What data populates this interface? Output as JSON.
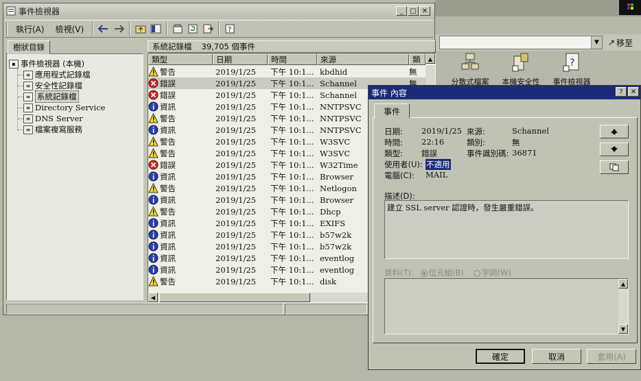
{
  "colors": {
    "title_active": "#1c2a78",
    "error_red": "#cc2b20",
    "warn_yellow": "#f4d820",
    "info_blue": "#2a3fa8"
  },
  "bg": {
    "move_label": "移至",
    "icons": [
      {
        "label": "分散式檔案",
        "icon": "dfs-icon"
      },
      {
        "label": "本機安全性",
        "icon": "local-security-icon"
      },
      {
        "label": "事件檢視器",
        "icon": "event-viewer-icon"
      }
    ]
  },
  "window": {
    "title": "事件檢視器",
    "menu": {
      "action": "執行(A)",
      "view": "檢視(V)"
    }
  },
  "tree": {
    "tab_label": "樹狀目錄",
    "root": "事件檢視器 (本機)",
    "items": [
      "應用程式記錄檔",
      "安全性記錄檔",
      "系統記錄檔",
      "Directory Service",
      "DNS Server",
      "檔案複寫服務"
    ]
  },
  "list": {
    "log_name": "系統記錄檔",
    "event_count": "39,705 個事件",
    "columns": {
      "type": "類型",
      "date": "日期",
      "time": "時間",
      "source": "來源",
      "category": "類"
    },
    "rows": [
      {
        "type": "警告",
        "kind": "warning",
        "date": "2019/1/25",
        "time": "下午 10:1...",
        "source": "kbdhid",
        "category": "無"
      },
      {
        "type": "錯誤",
        "kind": "error",
        "date": "2019/1/25",
        "time": "下午 10:1...",
        "source": "Schannel",
        "category": "無"
      },
      {
        "type": "錯誤",
        "kind": "error",
        "date": "2019/1/25",
        "time": "下午 10:1...",
        "source": "Schannel",
        "category": ""
      },
      {
        "type": "資訊",
        "kind": "info",
        "date": "2019/1/25",
        "time": "下午 10:1...",
        "source": "NNTPSVC",
        "category": ""
      },
      {
        "type": "警告",
        "kind": "warning",
        "date": "2019/1/25",
        "time": "下午 10:1...",
        "source": "NNTPSVC",
        "category": ""
      },
      {
        "type": "資訊",
        "kind": "info",
        "date": "2019/1/25",
        "time": "下午 10:1...",
        "source": "NNTPSVC",
        "category": ""
      },
      {
        "type": "警告",
        "kind": "warning",
        "date": "2019/1/25",
        "time": "下午 10:1...",
        "source": "W3SVC",
        "category": ""
      },
      {
        "type": "警告",
        "kind": "warning",
        "date": "2019/1/25",
        "time": "下午 10:1...",
        "source": "W3SVC",
        "category": ""
      },
      {
        "type": "錯誤",
        "kind": "error",
        "date": "2019/1/25",
        "time": "下午 10:1...",
        "source": "W32Time",
        "category": ""
      },
      {
        "type": "資訊",
        "kind": "info",
        "date": "2019/1/25",
        "time": "下午 10:1...",
        "source": "Browser",
        "category": ""
      },
      {
        "type": "警告",
        "kind": "warning",
        "date": "2019/1/25",
        "time": "下午 10:1...",
        "source": "Netlogon",
        "category": ""
      },
      {
        "type": "資訊",
        "kind": "info",
        "date": "2019/1/25",
        "time": "下午 10:1...",
        "source": "Browser",
        "category": ""
      },
      {
        "type": "警告",
        "kind": "warning",
        "date": "2019/1/25",
        "time": "下午 10:1...",
        "source": "Dhcp",
        "category": ""
      },
      {
        "type": "資訊",
        "kind": "info",
        "date": "2019/1/25",
        "time": "下午 10:1...",
        "source": "EXIFS",
        "category": ""
      },
      {
        "type": "資訊",
        "kind": "info",
        "date": "2019/1/25",
        "time": "下午 10:1...",
        "source": "b57w2k",
        "category": ""
      },
      {
        "type": "資訊",
        "kind": "info",
        "date": "2019/1/25",
        "time": "下午 10:1...",
        "source": "b57w2k",
        "category": ""
      },
      {
        "type": "資訊",
        "kind": "info",
        "date": "2019/1/25",
        "time": "下午 10:1...",
        "source": "eventlog",
        "category": ""
      },
      {
        "type": "資訊",
        "kind": "info",
        "date": "2019/1/25",
        "time": "下午 10:1...",
        "source": "eventlog",
        "category": ""
      },
      {
        "type": "警告",
        "kind": "warning",
        "date": "2019/1/25",
        "time": "下午 10:1...",
        "source": "disk",
        "category": ""
      }
    ]
  },
  "dialog": {
    "title": "事件 內容",
    "tab": "事件",
    "labels": {
      "date": "日期:",
      "time": "時間:",
      "type": "類型:",
      "user": "使用者(U):",
      "computer": "電腦(C):",
      "source": "來源:",
      "category": "類別:",
      "event_id": "事件識別碼:",
      "description": "描述(D):",
      "data": "資料(T):",
      "bytes": "位元組(B)",
      "words": "字詞(W)"
    },
    "values": {
      "date": "2019/1/25",
      "time": "22:16",
      "type": "錯誤",
      "user": "不適用",
      "computer": "MAIL",
      "source": "Schannel",
      "category": "無",
      "event_id": "36871",
      "description": "建立 SSL server 認證時，發生嚴重錯誤。"
    },
    "buttons": {
      "ok": "確定",
      "cancel": "取消",
      "apply": "套用(A)"
    }
  }
}
